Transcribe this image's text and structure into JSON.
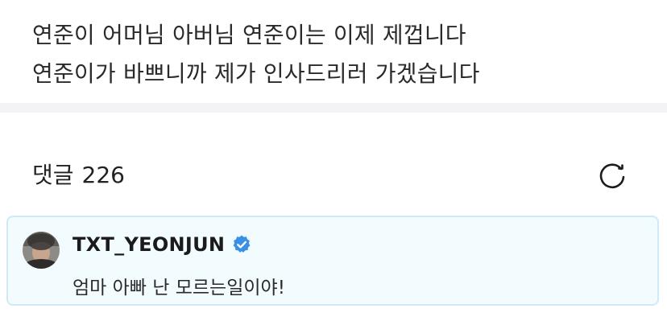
{
  "post": {
    "lines": [
      "연준이 어머님 아버님 연준이는 이제 제껍니다",
      "연준이가 바쁘니까 제가 인사드리러 가겠습니다"
    ]
  },
  "comments": {
    "title": "댓글",
    "count": "226",
    "refresh_icon": "refresh-icon"
  },
  "pinned_comment": {
    "author": "TXT_YEONJUN",
    "verified_icon": "verified-badge-icon",
    "text": "엄마 아빠 난 모르는일이야!"
  },
  "colors": {
    "divider": "#f3f3f6",
    "pinned_background": "#f2fbfe",
    "pinned_border": "#cfe9f6",
    "verified_badge": "#3a8fe6"
  }
}
